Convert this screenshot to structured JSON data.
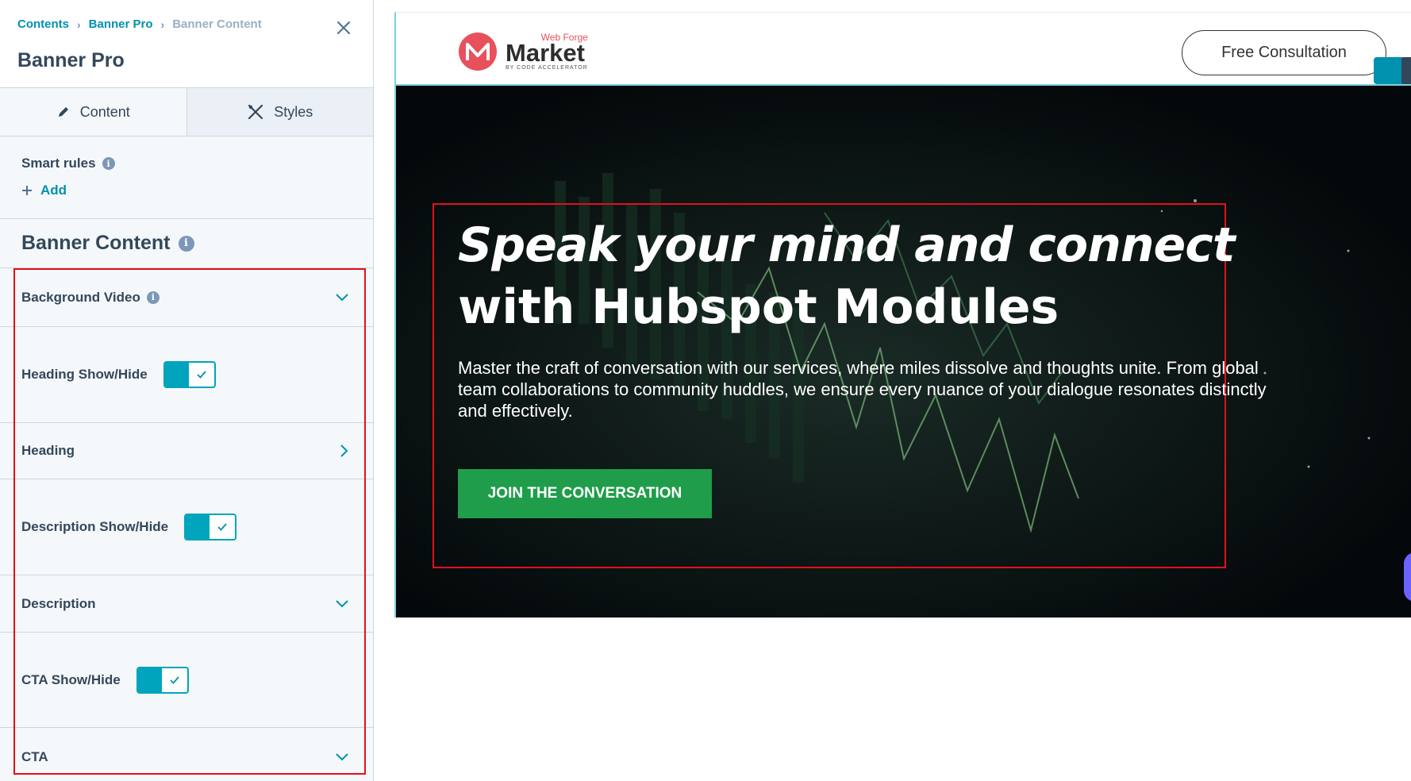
{
  "sidebar": {
    "breadcrumb": {
      "items": [
        "Contents",
        "Banner Pro"
      ],
      "current": "Banner Content"
    },
    "title": "Banner Pro",
    "tabs": [
      {
        "label": "Content",
        "icon": "pencil-icon",
        "active": true
      },
      {
        "label": "Styles",
        "icon": "styles-icon",
        "active": false
      }
    ],
    "smart_rules": {
      "label": "Smart rules",
      "add_label": "Add"
    },
    "section_title": "Banner Content",
    "fields": [
      {
        "label": "Background Video",
        "control": "chevron-down",
        "info": true
      },
      {
        "label": "Heading Show/Hide",
        "control": "toggle",
        "checked": true
      },
      {
        "label": "Heading",
        "control": "chevron-right"
      },
      {
        "label": "Description Show/Hide",
        "control": "toggle",
        "checked": true
      },
      {
        "label": "Description",
        "control": "chevron-down"
      },
      {
        "label": "CTA Show/Hide",
        "control": "toggle",
        "checked": true
      },
      {
        "label": "CTA",
        "control": "chevron-down"
      }
    ]
  },
  "preview": {
    "logo": {
      "top": "Web Forge",
      "main": "Market",
      "sub": "BY CODE ACCELERATOR"
    },
    "header_button": "Free Consultation",
    "hero": {
      "title_bold": "Speak your mind and connect",
      "title_rest": " with Hubspot Modules",
      "description": "Master the craft of conversation with our services, where miles dissolve and thoughts unite. From global team collaborations to community huddles, we ensure every nuance of your dialogue resonates distinctly and effectively.",
      "cta": "JOIN THE CONVERSATION"
    }
  },
  "colors": {
    "accent": "#0091ae",
    "toggle": "#00a4bd",
    "highlight": "#e3101a",
    "cta": "#1f9d4a",
    "logo": "#e8505b"
  }
}
